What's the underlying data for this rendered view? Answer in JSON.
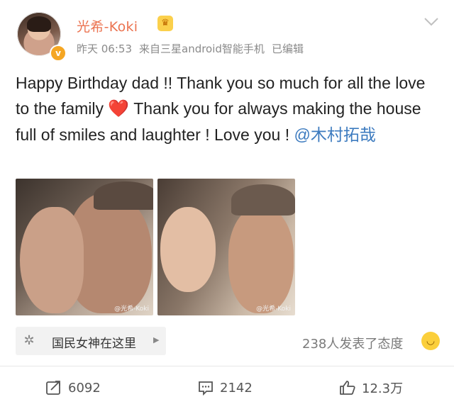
{
  "post": {
    "username": "光希-Koki",
    "time": "昨天 06:53",
    "source": "来自三星android智能手机",
    "edited": "已编辑",
    "text_1": "Happy Birthday dad !!  Thank you so much for all the love to the family ",
    "heart": "❤️",
    "text_2": " Thank you for always making the house full of smiles and laughter ! Love you ! ",
    "mention": "@木村拓哉",
    "watermark": "@光希-Koki"
  },
  "topic": {
    "label": "国民女神在这里"
  },
  "reactions": {
    "label": "238人发表了态度"
  },
  "actions": {
    "repost_count": "6092",
    "comment_count": "2142",
    "like_count": "12.3万"
  },
  "icons": [
    "verified-v-icon",
    "crown-icon",
    "chevron-down-icon",
    "topic-icon",
    "arrow-right-icon",
    "smile-emoji-icon",
    "repost-icon",
    "comment-icon",
    "like-icon"
  ]
}
